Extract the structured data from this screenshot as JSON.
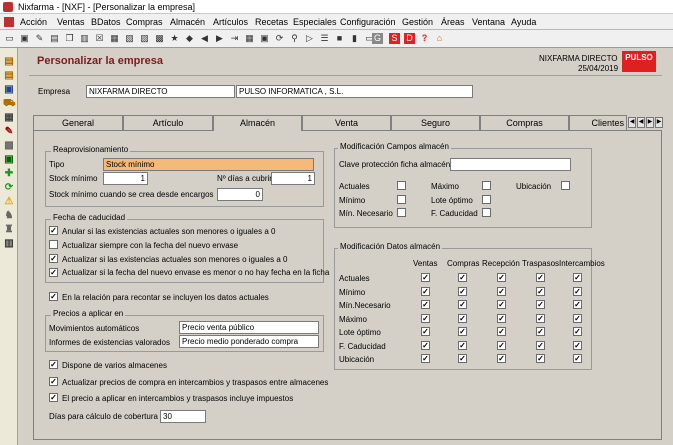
{
  "window": {
    "title": "Nixfarma - [NXF] - [Personalizar la empresa]"
  },
  "menu": [
    "Acción",
    "Ventas",
    "BDatos",
    "Compras",
    "Almacén",
    "Artículos",
    "Recetas",
    "Especiales",
    "Configuración",
    "Gestión",
    "Áreas",
    "Ventana",
    "Ayuda"
  ],
  "header": {
    "title": "Personalizar la empresa",
    "company": "NIXFARMA DIRECTO",
    "date": "25/04/2019",
    "logo": "PULSO"
  },
  "empresa": {
    "label": "Empresa",
    "code": "NIXFARMA DIRECTO",
    "name": "PULSO INFORMATICA , S.L."
  },
  "tabs": [
    "General",
    "Artículo",
    "Almacén",
    "Venta",
    "Seguro",
    "Compras",
    "Clientes"
  ],
  "reaprov": {
    "title": "Reaprovisionamiento",
    "tipo_label": "Tipo",
    "tipo_value": "Stock mínimo",
    "stock_min_label": "Stock mínimo",
    "stock_min_value": "1",
    "dias_label": "Nº días a cubrir",
    "dias_value": "1",
    "encargo_label": "Stock mínimo cuando se crea desde encargos",
    "encargo_value": "0"
  },
  "caducidad": {
    "title": "Fecha de caducidad",
    "options": [
      {
        "label": "Anular si las existencias actuales son menores o iguales a 0",
        "checked": "✓"
      },
      {
        "label": "Actualizar siempre con la fecha del nuevo envase",
        "checked": ""
      },
      {
        "label": "Actualizar si las existencias actuales son menores o iguales a 0",
        "checked": "✓"
      },
      {
        "label": "Actualizar si la fecha del nuevo envase es menor o no hay fecha en la ficha",
        "checked": "✓"
      }
    ]
  },
  "recontar": {
    "label": "En la relación para recontar se incluyen los datos actuales",
    "checked": "✓"
  },
  "precios": {
    "title": "Precios a aplicar en",
    "mov_label": "Movimientos automáticos",
    "mov_value": "Precio venta público",
    "inf_label": "Informes de existencias valorados",
    "inf_value": "Precio medio ponderado compra"
  },
  "bottom": [
    {
      "label": "Dispone de varios almacenes",
      "checked": "✓"
    },
    {
      "label": "Actualizar precios de compra en intercambios y traspasos entre almacenes",
      "checked": "✓"
    },
    {
      "label": "El precio a aplicar en intercambios y traspasos incluye impuestos",
      "checked": "✓"
    }
  ],
  "cobertura": {
    "label": "Días para cálculo de cobertura",
    "value": "30"
  },
  "modcampos": {
    "title": "Modificación Campos almacén",
    "clave_label": "Clave protección ficha almacén",
    "clave_value": "",
    "fields": [
      {
        "label": "Actuales",
        "checked": ""
      },
      {
        "label": "Máximo",
        "checked": ""
      },
      {
        "label": "Ubicación",
        "checked": ""
      },
      {
        "label": "Mínimo",
        "checked": ""
      },
      {
        "label": "Lote óptimo",
        "checked": ""
      },
      {
        "label": "Mín. Necesario",
        "checked": ""
      },
      {
        "label": "F. Caducidad",
        "checked": ""
      }
    ]
  },
  "moddatos": {
    "title": "Modificación Datos almacén",
    "columns": [
      "Ventas",
      "Compras",
      "Recepción",
      "Traspasos",
      "Intercambios"
    ],
    "rows": [
      {
        "label": "Actuales",
        "checks": [
          "✓",
          "✓",
          "✓",
          "✓",
          "✓"
        ]
      },
      {
        "label": "Mínimo",
        "checks": [
          "✓",
          "✓",
          "✓",
          "✓",
          "✓"
        ]
      },
      {
        "label": "Mín.Necesario",
        "checks": [
          "✓",
          "✓",
          "✓",
          "✓",
          "✓"
        ]
      },
      {
        "label": "Máximo",
        "checks": [
          "✓",
          "✓",
          "✓",
          "✓",
          "✓"
        ]
      },
      {
        "label": "Lote óptimo",
        "checks": [
          "✓",
          "✓",
          "✓",
          "✓",
          "✓"
        ]
      },
      {
        "label": "F. Caducidad",
        "checks": [
          "✓",
          "✓",
          "✓",
          "✓",
          "✓"
        ]
      },
      {
        "label": "Ubicación",
        "checks": [
          "✓",
          "✓",
          "✓",
          "✓",
          "✓"
        ]
      }
    ]
  },
  "colors": {
    "accent": "#7b1c1c",
    "highlight": "#f5b97a",
    "logo": "#e02020"
  }
}
